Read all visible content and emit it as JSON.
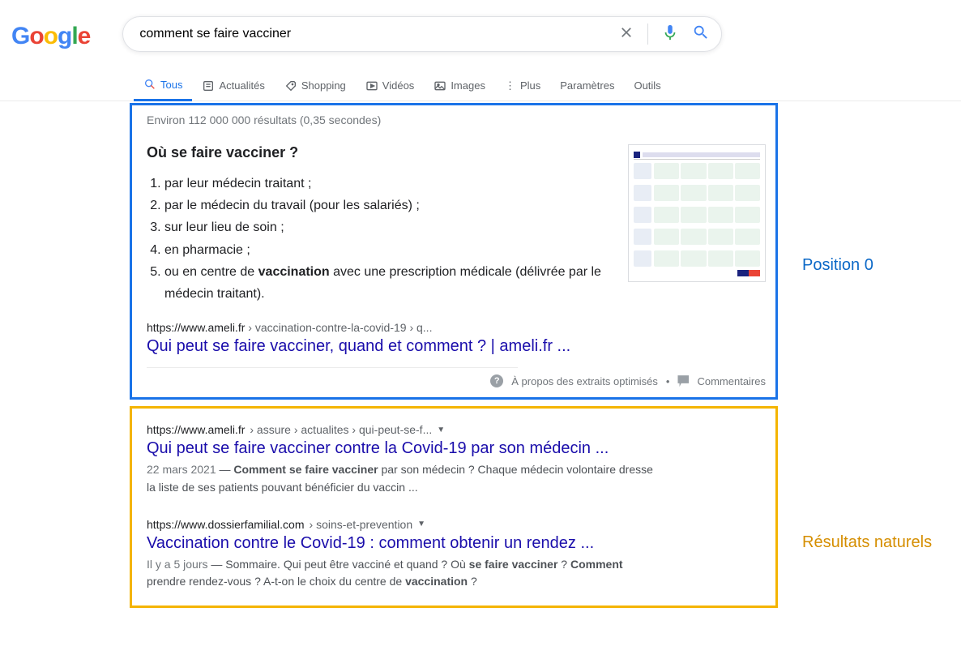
{
  "search": {
    "query": "comment se faire vacciner"
  },
  "tabs": {
    "tous": "Tous",
    "actualites": "Actualités",
    "shopping": "Shopping",
    "videos": "Vidéos",
    "images": "Images",
    "plus": "Plus",
    "parametres": "Paramètres",
    "outils": "Outils"
  },
  "stats": "Environ 112 000 000 résultats (0,35 secondes)",
  "featured": {
    "title": "Où se faire vacciner ?",
    "items": [
      "par leur médecin traitant ;",
      "par le médecin du travail (pour les salariés) ;",
      "sur leur lieu de soin ;",
      "en pharmacie ;",
      "ou en centre de vaccination avec une prescription médicale (délivrée par le médecin traitant)."
    ],
    "url_host": "https://www.ameli.fr",
    "url_path": " › vaccination-contre-la-covid-19 › q...",
    "link_title": "Qui peut se faire vacciner, quand et comment ? | ameli.fr ...",
    "about": "À propos des extraits optimisés",
    "comments": "Commentaires"
  },
  "results": [
    {
      "url_host": "https://www.ameli.fr",
      "url_path": " › assure › actualites › qui-peut-se-f...",
      "title": "Qui peut se faire vacciner contre la Covid-19 par son médecin ...",
      "date": "22 mars 2021",
      "desc_before": " — ",
      "desc": "Comment se faire vacciner par son médecin ? Chaque médecin volontaire dresse la liste de ses patients pouvant bénéficier du vaccin ..."
    },
    {
      "url_host": "https://www.dossierfamilial.com",
      "url_path": " › soins-et-prevention",
      "title": "Vaccination contre le Covid-19 : comment obtenir un rendez ...",
      "date": "Il y a 5 jours",
      "desc_before": " — ",
      "desc": "Sommaire. Qui peut être vacciné et quand ? Où se faire vacciner ? Comment prendre rendez-vous ? A-t-on le choix du centre de vaccination ?"
    }
  ],
  "annotations": {
    "position0": "Position 0",
    "naturals": "Résultats naturels"
  }
}
